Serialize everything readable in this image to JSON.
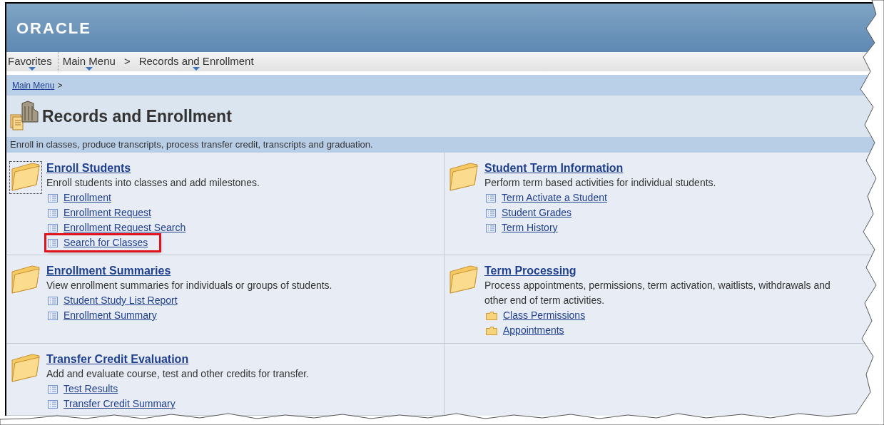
{
  "header": {
    "logo": "ORACLE"
  },
  "nav": [
    {
      "label": "Favorites",
      "dropdown": true
    },
    {
      "label": "Main Menu",
      "dropdown": true
    },
    {
      "label": ">",
      "dropdown": false
    },
    {
      "label": "Records and Enrollment",
      "dropdown": true
    }
  ],
  "breadcrumb": {
    "link": "Main Menu",
    "separator": ">"
  },
  "title": "Records and Enrollment",
  "description": "Enroll in classes, produce transcripts, process transfer credit, transcripts and graduation.",
  "sections": [
    {
      "title": "Enroll Students",
      "description": "Enroll students into classes and add milestones.",
      "focused": true,
      "links": [
        {
          "label": "Enrollment",
          "kind": "page",
          "highlighted": false
        },
        {
          "label": "Enrollment Request",
          "kind": "page",
          "highlighted": false
        },
        {
          "label": "Enrollment Request Search",
          "kind": "page",
          "highlighted": false
        },
        {
          "label": "Search for Classes",
          "kind": "page",
          "highlighted": true
        }
      ]
    },
    {
      "title": "Student Term Information",
      "description": "Perform term based activities for individual students.",
      "focused": false,
      "links": [
        {
          "label": "Term Activate a Student",
          "kind": "page",
          "highlighted": false
        },
        {
          "label": "Student Grades",
          "kind": "page",
          "highlighted": false
        },
        {
          "label": "Term History",
          "kind": "page",
          "highlighted": false
        }
      ]
    },
    {
      "title": "Enrollment Summaries",
      "description": "View enrollment summaries for individuals or groups of students.",
      "focused": false,
      "links": [
        {
          "label": "Student Study List Report",
          "kind": "page",
          "highlighted": false
        },
        {
          "label": "Enrollment Summary",
          "kind": "page",
          "highlighted": false
        }
      ]
    },
    {
      "title": "Term Processing",
      "description": "Process appointments, permissions, term activation, waitlists, withdrawals and other end of term activities.",
      "focused": false,
      "links": [
        {
          "label": "Class Permissions",
          "kind": "folder",
          "highlighted": false
        },
        {
          "label": "Appointments",
          "kind": "folder",
          "highlighted": false
        }
      ]
    },
    {
      "title": "Transfer Credit Evaluation",
      "description": "Add and evaluate course, test and other credits for transfer.",
      "focused": false,
      "links": [
        {
          "label": "Test Results",
          "kind": "page",
          "highlighted": false
        },
        {
          "label": "Transfer Credit Summary",
          "kind": "page",
          "highlighted": false
        }
      ]
    }
  ]
}
